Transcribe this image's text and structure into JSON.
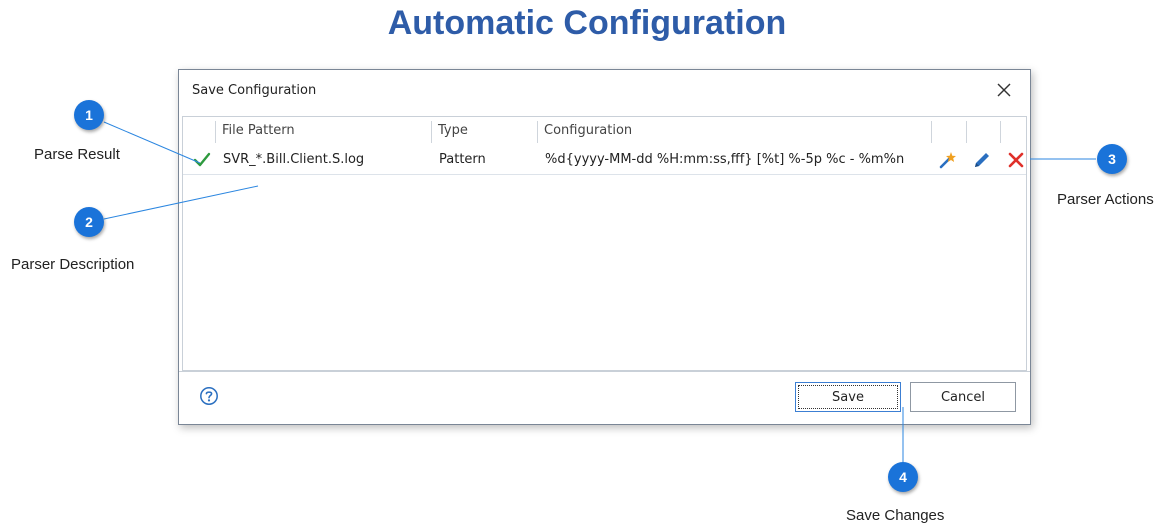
{
  "page": {
    "title": "Automatic Configuration"
  },
  "dialog": {
    "title": "Save Configuration",
    "columns": [
      "File Pattern",
      "Type",
      "Configuration"
    ],
    "rows": [
      {
        "file_pattern": "SVR_*.Bill.Client.S.log",
        "type": "Pattern",
        "configuration": "%d{yyyy-MM-dd %H:mm:ss,fff} [%t] %-5p %c - %m%n",
        "status_icon": "check-icon",
        "actions": [
          "wand-icon",
          "pencil-icon",
          "delete-icon"
        ]
      }
    ],
    "save_label": "Save",
    "cancel_label": "Cancel"
  },
  "callouts": [
    {
      "number": "1",
      "label": "Parse Result"
    },
    {
      "number": "2",
      "label": "Parser Description"
    },
    {
      "number": "3",
      "label": "Parser Actions"
    },
    {
      "number": "4",
      "label": "Save Changes"
    }
  ],
  "colors": {
    "title": "#2e5ca8",
    "badge": "#1a73d9",
    "check": "#2e9a3e",
    "delete": "#e0302a",
    "pencil": "#2a6fc0",
    "wand": "#f0a020"
  }
}
